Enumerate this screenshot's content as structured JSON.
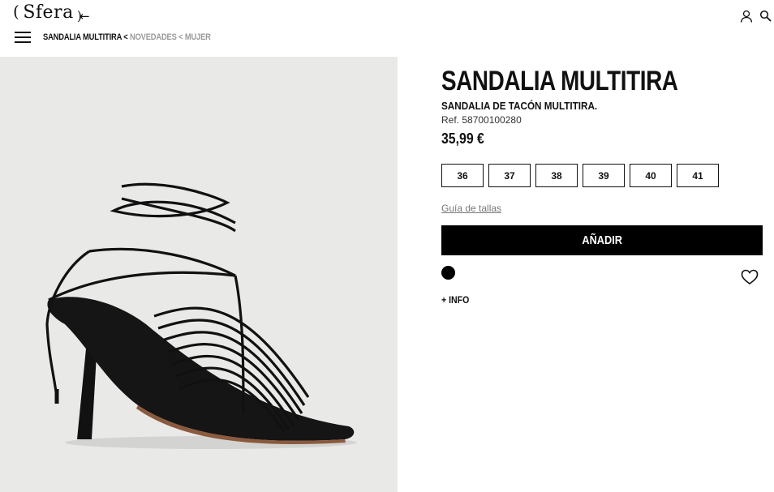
{
  "header": {
    "logo_text": "Sfera",
    "logo_paren_left": "(",
    "logo_paren_right": ")",
    "back_arrow": "←",
    "breadcrumb": {
      "current": "SANDALIA MULTITIRA",
      "separator": "<",
      "items": [
        "NOVEDADES",
        "MUJER"
      ]
    },
    "icons": [
      "menu-icon",
      "user-icon",
      "search-icon"
    ]
  },
  "product": {
    "title": "SANDALIA MULTITIRA",
    "subtitle": "SANDALIA DE TACÓN MULTITIRA.",
    "ref": "Ref. 58700100280",
    "price": "35,99 €",
    "sizes": [
      "36",
      "37",
      "38",
      "39",
      "40",
      "41"
    ],
    "size_guide_label": "Guía de tallas",
    "add_label": "AÑADIR",
    "color_swatch": "#000000",
    "more_info_label": "+ INFO"
  },
  "colors": {
    "image_background": "#e9eae8",
    "button_background": "#000000",
    "muted_text": "#9a9a9a"
  }
}
